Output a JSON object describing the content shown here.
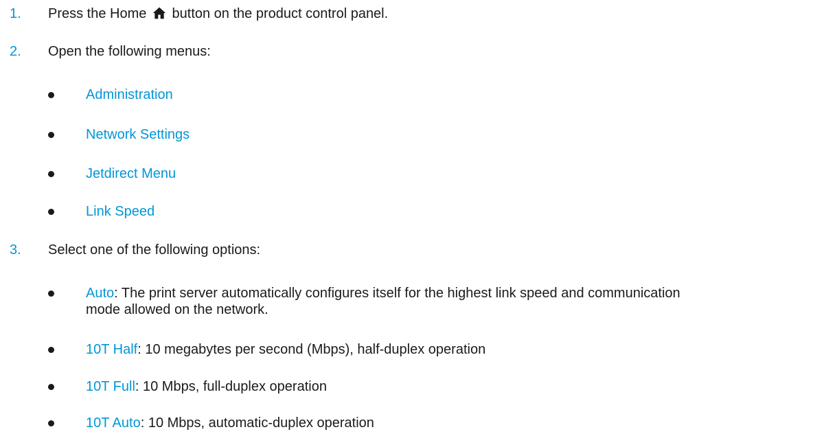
{
  "steps": [
    {
      "number": "1.",
      "text_before": "Press the Home",
      "icon": "home-icon",
      "text_after": "button on the product control panel."
    },
    {
      "number": "2.",
      "text": "Open the following menus:",
      "menus": [
        {
          "label": "Administration"
        },
        {
          "label": "Network Settings"
        },
        {
          "label": "Jetdirect Menu"
        },
        {
          "label": "Link Speed"
        }
      ]
    },
    {
      "number": "3.",
      "text": "Select one of the following options:",
      "options": [
        {
          "label": "Auto",
          "desc": ": The print server automatically configures itself for the highest link speed and communication",
          "desc2": "mode allowed on the network."
        },
        {
          "label": "10T Half",
          "desc": ": 10 megabytes per second (Mbps), half-duplex operation"
        },
        {
          "label": "10T Full",
          "desc": ": 10 Mbps, full-duplex operation"
        },
        {
          "label": "10T Auto",
          "desc": ": 10 Mbps, automatic-duplex operation"
        }
      ]
    }
  ],
  "colors": {
    "accent": "#0096d6",
    "text": "#1a1a1a"
  }
}
